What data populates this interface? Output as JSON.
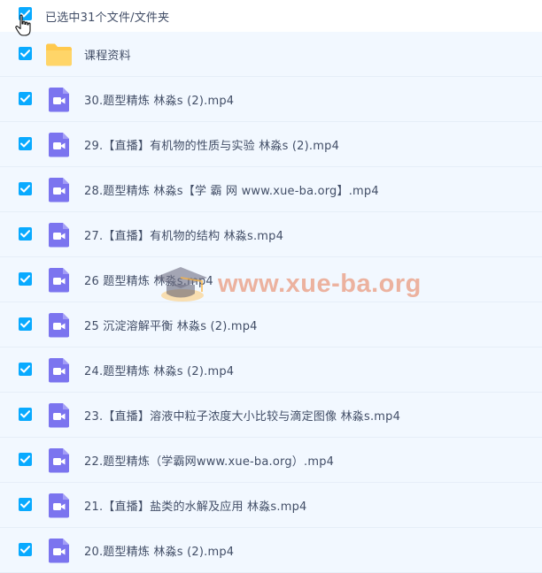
{
  "header": {
    "selection_text": "已选中31个文件/文件夹"
  },
  "files": [
    {
      "name": "课程资料",
      "type": "folder"
    },
    {
      "name": "30.题型精炼 林淼s (2).mp4",
      "type": "video"
    },
    {
      "name": "29.【直播】有机物的性质与实验 林淼s (2).mp4",
      "type": "video"
    },
    {
      "name": "28.题型精炼 林淼s【学 霸 网 www.xue-ba.org】.mp4",
      "type": "video"
    },
    {
      "name": "27.【直播】有机物的结构 林淼s.mp4",
      "type": "video"
    },
    {
      "name": "26 题型精炼 林淼s.mp4",
      "type": "video"
    },
    {
      "name": "25 沉淀溶解平衡 林淼s (2).mp4",
      "type": "video"
    },
    {
      "name": "24.题型精炼 林淼s (2).mp4",
      "type": "video"
    },
    {
      "name": "23.【直播】溶液中粒子浓度大小比较与滴定图像 林淼s.mp4",
      "type": "video"
    },
    {
      "name": "22.题型精炼（学霸网www.xue-ba.org）.mp4",
      "type": "video"
    },
    {
      "name": "21.【直播】盐类的水解及应用 林淼s.mp4",
      "type": "video"
    },
    {
      "name": "20.题型精炼 林淼s (2).mp4",
      "type": "video"
    }
  ],
  "watermark": {
    "text": "www.xue-ba.org"
  },
  "colors": {
    "checkbox": "#09aaff",
    "row_background": "#f2f8ff",
    "folder": "#ffc94d",
    "video_icon": "#7b74ef",
    "text": "#424e67"
  }
}
